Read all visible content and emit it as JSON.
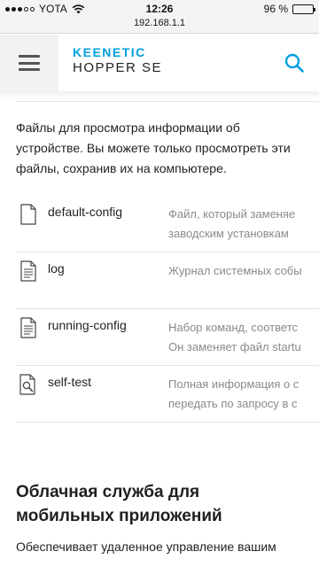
{
  "status_bar": {
    "carrier": "YOTA",
    "time": "12:26",
    "url": "192.168.1.1",
    "battery_percent": "96 %",
    "battery_level": 0.96
  },
  "header": {
    "brand_line1": "KEENETIC",
    "brand_line2": "HOPPER SE",
    "menu_icon": "hamburger-menu-icon",
    "search_icon": "search-icon",
    "accent_color": "#00a0df"
  },
  "intro_text": "Файлы для просмотра информации об устройстве. Вы можете только просмотреть эти файлы, сохранив их на компьютере.",
  "files": [
    {
      "name": "default-config",
      "icon": "file-blank-icon",
      "desc_line1": "Файл, который заменяе",
      "desc_line2": "заводским установкам"
    },
    {
      "name": "log",
      "icon": "file-text-icon",
      "desc_line1": "Журнал системных собы",
      "desc_line2": ""
    },
    {
      "name": "running-config",
      "icon": "file-text-icon",
      "desc_line1": "Набор команд, соответс",
      "desc_line2": "Он заменяет файл startu"
    },
    {
      "name": "self-test",
      "icon": "file-search-icon",
      "desc_line1": "Полная информация о с",
      "desc_line2": "передать по запросу в с"
    }
  ],
  "section": {
    "title": "Облачная служба для мобильных приложений",
    "text": "Обеспечивает удаленное управление вашим"
  }
}
